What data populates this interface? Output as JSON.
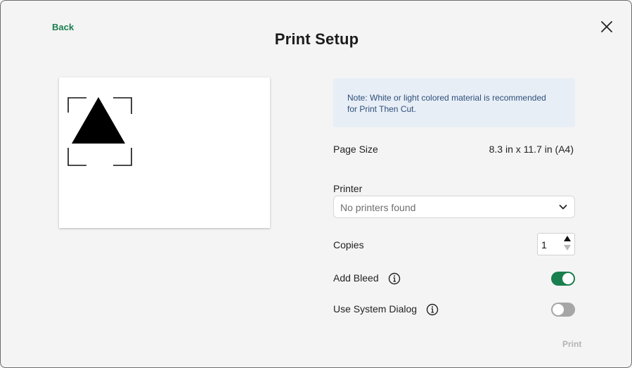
{
  "header": {
    "back_label": "Back",
    "title": "Print Setup"
  },
  "note": {
    "text_line1": "Note: White or light colored material is recommended",
    "text_line2": "for Print Then Cut."
  },
  "page_size": {
    "label": "Page Size",
    "value": "8.3 in x 11.7 in (A4)"
  },
  "printer": {
    "label": "Printer",
    "selected": "No printers found"
  },
  "copies": {
    "label": "Copies",
    "value": "1"
  },
  "add_bleed": {
    "label": "Add Bleed",
    "enabled": true
  },
  "system_dialog": {
    "label": "Use System Dialog",
    "enabled": false
  },
  "footer": {
    "print_label": "Print"
  },
  "colors": {
    "accent": "#1a7f4f",
    "note_bg": "#e8eef6",
    "note_text": "#2d4f7a",
    "toggle_off": "#a6a6a6",
    "disabled_text": "#b3b3b3"
  },
  "icons": [
    "close-icon",
    "chevron-down-icon",
    "info-icon",
    "stepper-up-icon",
    "stepper-down-icon"
  ]
}
